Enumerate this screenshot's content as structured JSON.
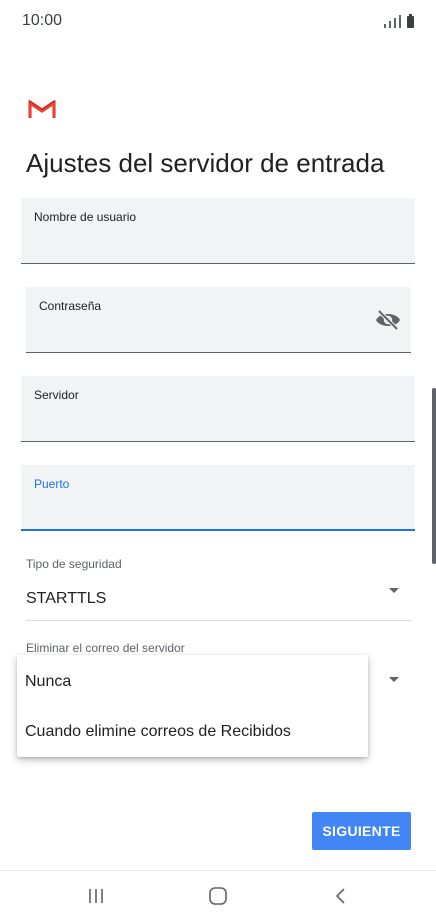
{
  "status_bar": {
    "time": "10:00"
  },
  "page": {
    "title": "Ajustes del servidor de entrada"
  },
  "fields": {
    "username": {
      "label": "Nombre de usuario",
      "value": ""
    },
    "password": {
      "label": "Contraseña",
      "value": ""
    },
    "server": {
      "label": "Servidor",
      "value": ""
    },
    "port": {
      "label": "Puerto",
      "value": ""
    }
  },
  "security": {
    "label": "Tipo de seguridad",
    "value": "STARTTLS"
  },
  "delete_from_server": {
    "label": "Eliminar el correo del servidor",
    "options": [
      "Nunca",
      "Cuando elimine correos de Recibidos"
    ]
  },
  "actions": {
    "next": "SIGUIENTE"
  },
  "icons": {
    "logo": "gmail-logo",
    "password_toggle": "eye-off-icon",
    "nav_recents": "recents-icon",
    "nav_home": "home-icon",
    "nav_back": "back-icon"
  },
  "colors": {
    "accent": "#1a73e8",
    "button": "#4285f4",
    "gmail_red": "#ea4335"
  }
}
